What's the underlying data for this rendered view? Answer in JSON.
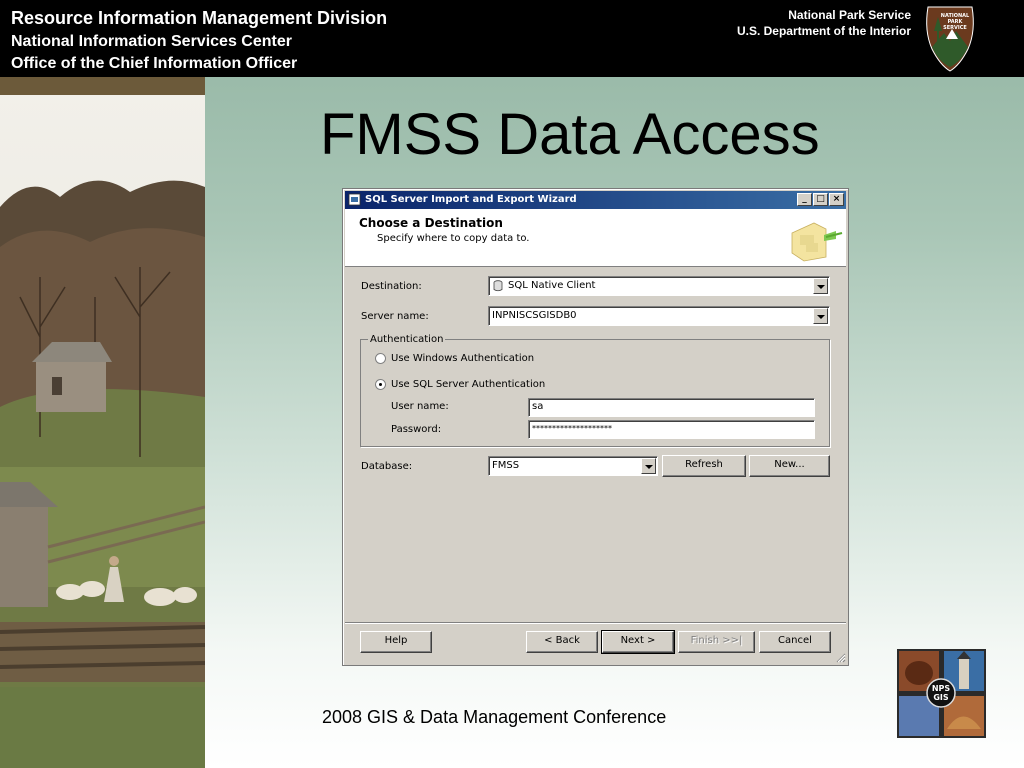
{
  "header": {
    "org_line1": "Resource Information Management Division",
    "org_line2": "National Information Services Center",
    "org_line3": "Office of the Chief Information Officer",
    "agency_line1": "National Park Service",
    "agency_line2": "U.S. Department of the Interior",
    "logo_text": "NATIONAL PARK SERVICE"
  },
  "slide": {
    "title": "FMSS Data Access",
    "footer": "2008 GIS & Data Management Conference",
    "gis_logo_text": "NPS GIS"
  },
  "dialog": {
    "title": "SQL Server Import and Export Wizard",
    "banner_title": "Choose a Destination",
    "banner_subtitle": "Specify where to copy data to.",
    "destination_label": "Destination:",
    "destination_value": "SQL Native Client",
    "server_label": "Server name:",
    "server_value": "INPNISCSGISDB0",
    "auth_group": "Authentication",
    "auth_windows": "Use Windows Authentication",
    "auth_sql": "Use SQL Server Authentication",
    "selected_auth": "sql",
    "username_label": "User name:",
    "username_value": "sa",
    "password_label": "Password:",
    "password_value": "********************",
    "database_label": "Database:",
    "database_value": "FMSS",
    "refresh_button": "Refresh",
    "new_button": "New...",
    "help_button": "Help",
    "back_button": "< Back",
    "next_button": "Next >",
    "finish_button": "Finish >>|",
    "cancel_button": "Cancel",
    "minimize_glyph": "_",
    "maximize_glyph": "□",
    "close_glyph": "×"
  },
  "colors": {
    "header_bg": "#000000",
    "titlebar_start": "#0a246a",
    "titlebar_end": "#3a6ea5",
    "dialog_face": "#d4d0c8",
    "slide_bg_top": "#93b5a3"
  }
}
